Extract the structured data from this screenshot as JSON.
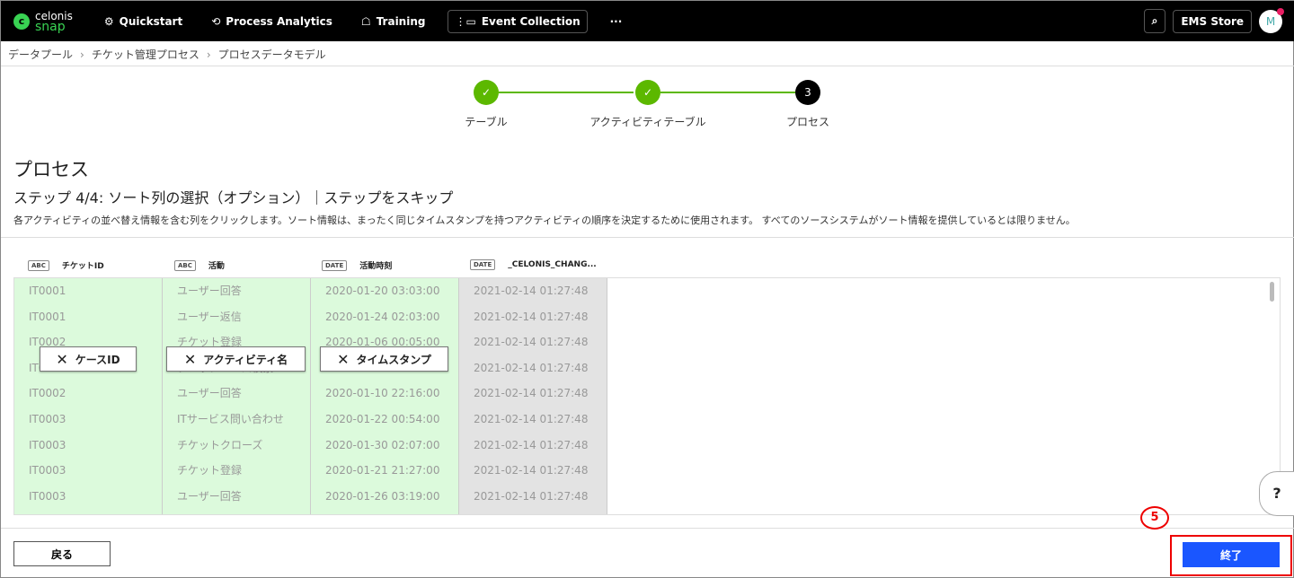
{
  "topbar": {
    "logo_top": "celonis",
    "logo_bottom": "snap",
    "nav": [
      {
        "icon": "⚙",
        "label": "Quickstart"
      },
      {
        "icon": "⟲",
        "label": "Process Analytics"
      },
      {
        "icon": "☖",
        "label": "Training"
      },
      {
        "icon": "⋮▭",
        "label": "Event Collection"
      }
    ],
    "more": "···",
    "search": "⌕",
    "store": "EMS Store",
    "avatar": "M"
  },
  "breadcrumb": [
    "データプール",
    "チケット管理プロセス",
    "プロセスデータモデル"
  ],
  "stepper": [
    {
      "label": "テーブル",
      "mark": "✓"
    },
    {
      "label": "アクティビティテーブル",
      "mark": "✓"
    },
    {
      "label": "プロセス",
      "mark": "3"
    }
  ],
  "colors": {
    "done": "#5cb800",
    "active": "#000000",
    "primary": "#1a56ff"
  },
  "title": "プロセス",
  "subtitle": "ステップ 4/4: ソート列の選択（オプション）｜ステップをスキップ",
  "description": "各アクティビティの並べ替え情報を含む列をクリックします。ソート情報は、まったく同じタイムスタンプを持つアクティビティの順序を決定するために使用されます。 すべてのソースシステムがソート情報を提供しているとは限りません。",
  "columns": [
    {
      "type": "ABC",
      "name": "チケットID",
      "chip": "ケースID",
      "values": [
        "IT0001",
        "IT0001",
        "IT0002",
        "IT0002",
        "IT0002",
        "IT0003",
        "IT0003",
        "IT0003",
        "IT0003"
      ]
    },
    {
      "type": "ABC",
      "name": "活動",
      "chip": "アクティビティ名",
      "values": [
        "ユーザー回答",
        "ユーザー返信",
        "チケット登録",
        "ナレッジベース検索",
        "ユーザー回答",
        "ITサービス問い合わせ",
        "チケットクローズ",
        "チケット登録",
        "ユーザー回答"
      ]
    },
    {
      "type": "DATE",
      "name": "活動時刻",
      "chip": "タイムスタンプ",
      "values": [
        "2020-01-20 03:03:00",
        "2020-01-24 02:03:00",
        "2020-01-06 00:05:00",
        "2020-01-06 21:32:00",
        "2020-01-10 22:16:00",
        "2020-01-22 00:54:00",
        "2020-01-30 02:07:00",
        "2020-01-21 21:27:00",
        "2020-01-26 03:19:00"
      ]
    },
    {
      "type": "DATE",
      "name": "_CELONIS_CHANG...",
      "values": [
        "2021-02-14 01:27:48",
        "2021-02-14 01:27:48",
        "2021-02-14 01:27:48",
        "2021-02-14 01:27:48",
        "2021-02-14 01:27:48",
        "2021-02-14 01:27:48",
        "2021-02-14 01:27:48",
        "2021-02-14 01:27:48",
        "2021-02-14 01:27:48"
      ]
    }
  ],
  "footer": {
    "back": "戻る",
    "finish": "終了",
    "marker": "5",
    "help": "?"
  }
}
